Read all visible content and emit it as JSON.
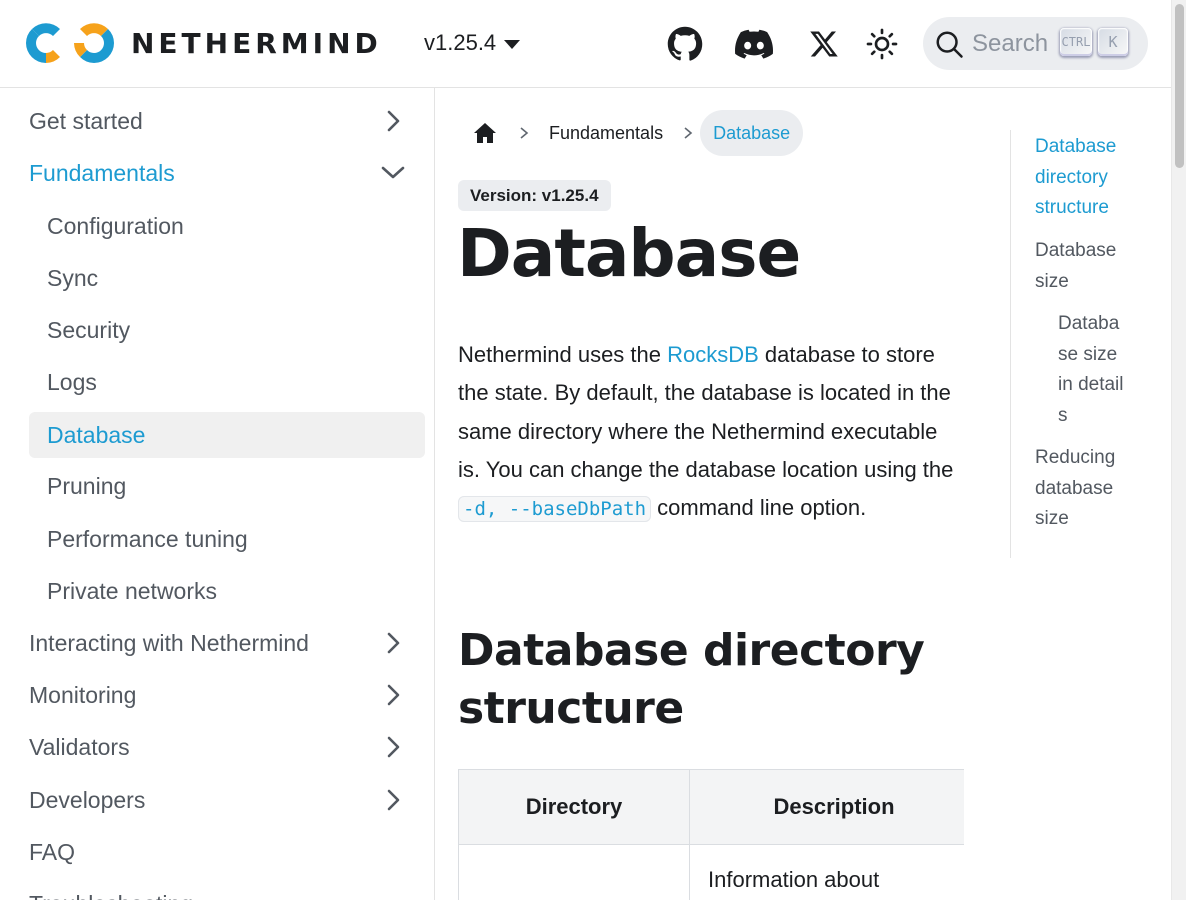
{
  "navbar": {
    "brand": "NETHERMIND",
    "version": "v1.25.4",
    "icons": [
      "github-icon",
      "discord-icon",
      "x-icon",
      "theme-toggle-icon"
    ],
    "search": {
      "placeholder": "Search",
      "shortcut_ctrl": "CTRL",
      "shortcut_k": "K"
    }
  },
  "sidebar": {
    "items": [
      {
        "label": "Get started",
        "level": 0,
        "state": "collapsed"
      },
      {
        "label": "Fundamentals",
        "level": 0,
        "state": "expanded"
      },
      {
        "label": "Configuration",
        "level": 1
      },
      {
        "label": "Sync",
        "level": 1
      },
      {
        "label": "Security",
        "level": 1
      },
      {
        "label": "Logs",
        "level": 1
      },
      {
        "label": "Database",
        "level": 1,
        "active": true
      },
      {
        "label": "Pruning",
        "level": 1
      },
      {
        "label": "Performance tuning",
        "level": 1
      },
      {
        "label": "Private networks",
        "level": 1
      },
      {
        "label": "Interacting with Nethermind",
        "level": 0,
        "state": "collapsed"
      },
      {
        "label": "Monitoring",
        "level": 0,
        "state": "collapsed"
      },
      {
        "label": "Validators",
        "level": 0,
        "state": "collapsed"
      },
      {
        "label": "Developers",
        "level": 0,
        "state": "collapsed"
      },
      {
        "label": "FAQ",
        "level": 0
      },
      {
        "label": "Troubleshooting",
        "level": 0
      }
    ]
  },
  "breadcrumb": {
    "items": [
      "Fundamentals",
      "Database"
    ]
  },
  "page": {
    "version_badge": "Version: v1.25.4",
    "title": "Database",
    "intro_1": "Nethermind uses the ",
    "intro_link": "RocksDB",
    "intro_2": " database to store the state. By default, the database is located in the same directory where the Nethermind executable is. You can change the database location using the ",
    "intro_code": "-d, --baseDbPath",
    "intro_3": " command line option.",
    "section_title": "Database directory structure",
    "table": {
      "headers": [
        "Directory",
        "Description"
      ],
      "rows": [
        [
          "",
          "Information about"
        ]
      ]
    }
  },
  "toc": {
    "items": [
      {
        "label": "Database directory structure",
        "active": true
      },
      {
        "label": "Database size"
      },
      {
        "label": "Database size in details",
        "nested": true
      },
      {
        "label": "Reducing database size"
      }
    ]
  },
  "colors": {
    "accent": "#1d9bd1",
    "logo_blue": "#1d9bd1",
    "logo_orange": "#f6a21b"
  }
}
